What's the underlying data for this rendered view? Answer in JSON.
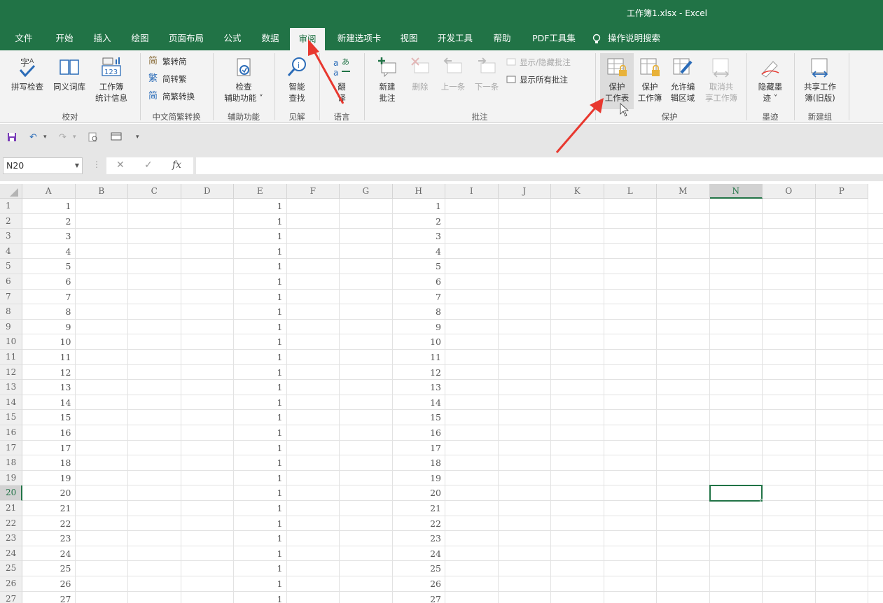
{
  "window": {
    "title": "工作簿1.xlsx  -  Excel"
  },
  "tabs": [
    {
      "label": "文件"
    },
    {
      "label": "开始"
    },
    {
      "label": "插入"
    },
    {
      "label": "绘图"
    },
    {
      "label": "页面布局"
    },
    {
      "label": "公式"
    },
    {
      "label": "数据"
    },
    {
      "label": "审阅"
    },
    {
      "label": "新建选项卡"
    },
    {
      "label": "视图"
    },
    {
      "label": "开发工具"
    },
    {
      "label": "帮助"
    },
    {
      "label": "PDF工具集"
    },
    {
      "label": "操作说明搜索"
    }
  ],
  "active_tab": "审阅",
  "ribbon": {
    "proofing": {
      "label": "校对",
      "spell": "拼写检查",
      "thesaurus": "同义词库",
      "stats_1": "工作簿",
      "stats_2": "统计信息"
    },
    "chinese": {
      "label": "中文简繁转换",
      "t2s": "繁转简",
      "s2t": "简转繁",
      "convert": "简繁转换"
    },
    "accessibility": {
      "label": "辅助功能",
      "check_1": "检查",
      "check_2": "辅助功能 ˅"
    },
    "insights": {
      "label": "见解",
      "smart_1": "智能",
      "smart_2": "查找"
    },
    "language": {
      "label": "语言",
      "translate_1": "翻",
      "translate_2": "译"
    },
    "comments": {
      "label": "批注",
      "new_1": "新建",
      "new_2": "批注",
      "delete": "删除",
      "prev": "上一条",
      "next": "下一条",
      "show_hide": "显示/隐藏批注",
      "show_all": "显示所有批注"
    },
    "protect": {
      "label": "保护",
      "sheet_1": "保护",
      "sheet_2": "工作表",
      "book_1": "保护",
      "book_2": "工作簿",
      "ranges_1": "允许编",
      "ranges_2": "辑区域",
      "unshare_1": "取消共",
      "unshare_2": "享工作簿"
    },
    "ink": {
      "label": "墨迹",
      "hide_1": "隐藏墨",
      "hide_2": "迹 ˅"
    },
    "newgroup": {
      "label": "新建组",
      "share_1": "共享工作",
      "share_2": "簿(旧版)"
    }
  },
  "formula_bar": {
    "name_box": "N20",
    "fx": "fx",
    "cancel": "✕",
    "enter": "✓",
    "formula": ""
  },
  "columns": [
    "A",
    "B",
    "C",
    "D",
    "E",
    "F",
    "G",
    "H",
    "I",
    "J",
    "K",
    "L",
    "M",
    "N",
    "O",
    "P"
  ],
  "selected_cell": "N20",
  "rows": [
    {
      "n": "1",
      "a": "1",
      "e": "1",
      "h": "1"
    },
    {
      "n": "2",
      "a": "2",
      "e": "1",
      "h": "2"
    },
    {
      "n": "3",
      "a": "3",
      "e": "1",
      "h": "3"
    },
    {
      "n": "4",
      "a": "4",
      "e": "1",
      "h": "4"
    },
    {
      "n": "5",
      "a": "5",
      "e": "1",
      "h": "5"
    },
    {
      "n": "6",
      "a": "6",
      "e": "1",
      "h": "6"
    },
    {
      "n": "7",
      "a": "7",
      "e": "1",
      "h": "7"
    },
    {
      "n": "8",
      "a": "8",
      "e": "1",
      "h": "8"
    },
    {
      "n": "9",
      "a": "9",
      "e": "1",
      "h": "9"
    },
    {
      "n": "10",
      "a": "10",
      "e": "1",
      "h": "10"
    },
    {
      "n": "11",
      "a": "11",
      "e": "1",
      "h": "11"
    },
    {
      "n": "12",
      "a": "12",
      "e": "1",
      "h": "12"
    },
    {
      "n": "13",
      "a": "13",
      "e": "1",
      "h": "13"
    },
    {
      "n": "14",
      "a": "14",
      "e": "1",
      "h": "14"
    },
    {
      "n": "15",
      "a": "15",
      "e": "1",
      "h": "15"
    },
    {
      "n": "16",
      "a": "16",
      "e": "1",
      "h": "16"
    },
    {
      "n": "17",
      "a": "17",
      "e": "1",
      "h": "17"
    },
    {
      "n": "18",
      "a": "18",
      "e": "1",
      "h": "18"
    },
    {
      "n": "19",
      "a": "19",
      "e": "1",
      "h": "19"
    },
    {
      "n": "20",
      "a": "20",
      "e": "1",
      "h": "20"
    },
    {
      "n": "21",
      "a": "21",
      "e": "1",
      "h": "21"
    },
    {
      "n": "22",
      "a": "22",
      "e": "1",
      "h": "22"
    },
    {
      "n": "23",
      "a": "23",
      "e": "1",
      "h": "23"
    },
    {
      "n": "24",
      "a": "24",
      "e": "1",
      "h": "24"
    },
    {
      "n": "25",
      "a": "25",
      "e": "1",
      "h": "25"
    },
    {
      "n": "26",
      "a": "26",
      "e": "1",
      "h": "26"
    },
    {
      "n": "27",
      "a": "27",
      "e": "1",
      "h": "27"
    }
  ],
  "colors": {
    "brand": "#217346",
    "annotation": "#e8382f"
  }
}
